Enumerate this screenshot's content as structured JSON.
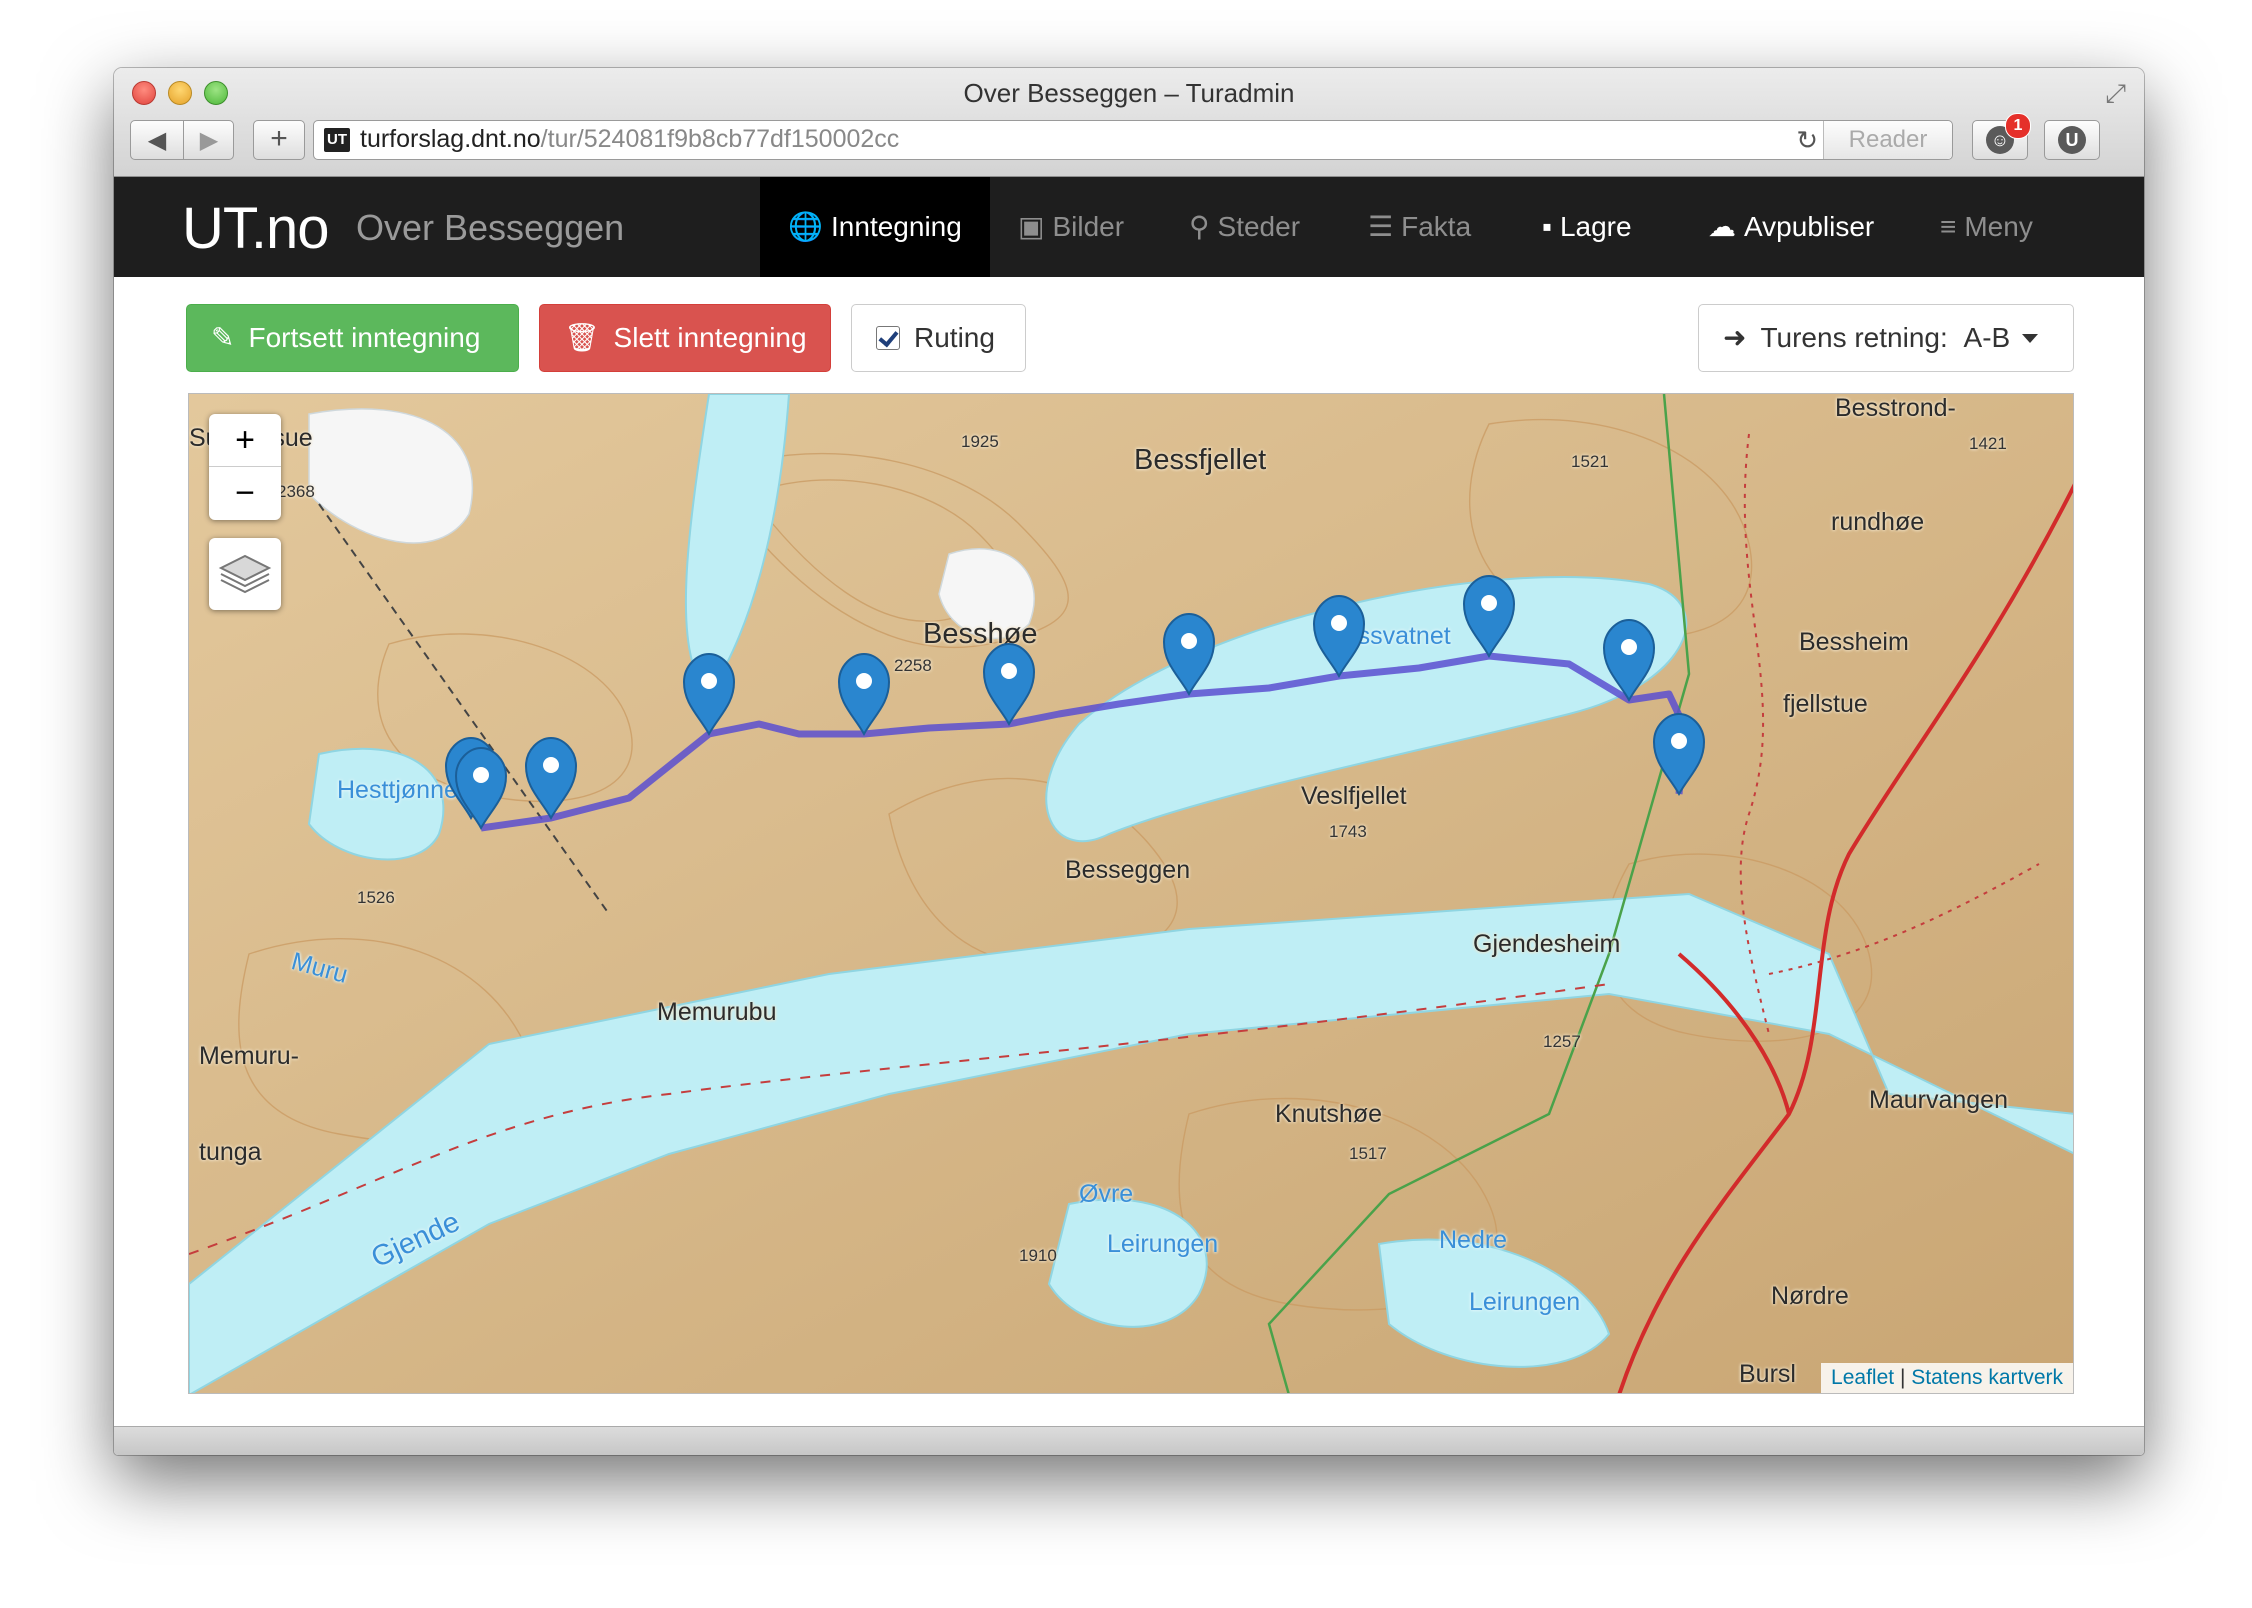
{
  "window": {
    "title": "Over Besseggen – Turadmin"
  },
  "toolbar": {
    "back_icon": "◀",
    "forward_icon": "▶",
    "new_tab_icon": "+",
    "favicon_text": "UT",
    "url_host": "turforslag.dnt.no",
    "url_path": "/tur/524081f9b8cb77df150002cc",
    "reader_label": "Reader",
    "notification_count": "1",
    "ext_labels": [
      "U"
    ]
  },
  "navbar": {
    "brand": "UT.no",
    "subtitle": "Over Besseggen",
    "items": [
      {
        "label": "Inntegning",
        "icon": "globe-icon"
      },
      {
        "label": "Bilder",
        "icon": "image-icon"
      },
      {
        "label": "Steder",
        "icon": "map-marker-icon"
      },
      {
        "label": "Fakta",
        "icon": "list-icon"
      },
      {
        "label": "Lagre",
        "icon": "save-icon"
      },
      {
        "label": "Avpubliser",
        "icon": "cloud-download-icon"
      },
      {
        "label": "Meny",
        "icon": "menu-icon"
      }
    ]
  },
  "actions": {
    "continue_label": "Fortsett inntegning",
    "delete_label": "Slett inntegning",
    "routing_label": "Ruting",
    "routing_checked": true,
    "direction_prefix": "Turens retning:",
    "direction_value": "A-B"
  },
  "map": {
    "zoom_in": "+",
    "zoom_out": "−",
    "attribution_leaflet": "Leaflet",
    "attribution_separator": "|",
    "attribution_source": "Statens kartverk",
    "colors": {
      "terrain": "#d6b98a",
      "water": "#bfeef5",
      "route": "#5a4fd0",
      "marker": "#2a86cf",
      "road": "#d22b2b"
    },
    "labels": {
      "sulingssue": "Su  ingssue",
      "e2368": "2368",
      "e1925": "1925",
      "bessfjellet": "Bessfjellet",
      "e1521": "1521",
      "besstrond": "Besstrond-",
      "e1421": "1421",
      "rundhoe": "rundhøe",
      "besshoe": "Besshøe",
      "e2258": "2258",
      "bessvatnet": "Bessvatnet",
      "bessheim": "Bessheim",
      "fjellstue": "fjellstue",
      "hesttjonne": "Hesttjønne",
      "vesljellet": "Veslfjellet",
      "e1743": "1743",
      "besseggen": "Besseggen",
      "e1526": "1526",
      "muru": "Muru",
      "gjendesheim": "Gjendesheim",
      "memurubu": "Memurubu",
      "memuru": "Memuru-",
      "tunga": "tunga",
      "e1257": "1257",
      "maurvangen": "Maurvangen",
      "knutshoe": "Knutshøe",
      "e1517": "1517",
      "ovre": "Øvre",
      "leirungen1": "Leirungen",
      "gjende": "Gjende",
      "e1910": "1910",
      "nedre": "Nedre",
      "leirungen2": "Leirungen",
      "nordre": "Nørdre",
      "brurs": "Bursl"
    }
  }
}
